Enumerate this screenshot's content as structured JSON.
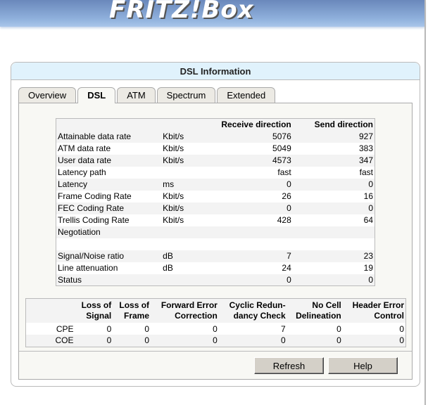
{
  "logo": "FRITZ!Box",
  "title": "DSL Information",
  "tabs": [
    "Overview",
    "DSL",
    "ATM",
    "Spectrum",
    "Extended"
  ],
  "active_tab": "DSL",
  "dsl_table": {
    "headers": [
      "",
      "",
      "Receive direction",
      "Send direction"
    ],
    "rows": [
      [
        "Attainable data rate",
        "Kbit/s",
        "5076",
        "927"
      ],
      [
        "ATM data rate",
        "Kbit/s",
        "5049",
        "383"
      ],
      [
        "User data rate",
        "Kbit/s",
        "4573",
        "347"
      ],
      [
        "Latency path",
        "",
        "fast",
        "fast"
      ],
      [
        "Latency",
        "ms",
        "0",
        "0"
      ],
      [
        "Frame Coding Rate",
        "Kbit/s",
        "26",
        "16"
      ],
      [
        "FEC Coding Rate",
        "Kbit/s",
        "0",
        "0"
      ],
      [
        "Trellis Coding Rate",
        "Kbit/s",
        "428",
        "64"
      ],
      [
        "Negotiation",
        "",
        "",
        ""
      ],
      [
        "",
        "",
        "",
        ""
      ],
      [
        "Signal/Noise ratio",
        "dB",
        "7",
        "23"
      ],
      [
        "Line attenuation",
        "dB",
        "24",
        "19"
      ],
      [
        "Status",
        "",
        "0",
        "0"
      ]
    ]
  },
  "error_table": {
    "headers": [
      [
        "Loss of",
        "Signal"
      ],
      [
        "Loss of",
        "Frame"
      ],
      [
        "Forward Error",
        "Correction"
      ],
      [
        "Cyclic Redun-",
        "dancy Check"
      ],
      [
        "No Cell",
        "Delineation"
      ],
      [
        "Header Error",
        "Control"
      ]
    ],
    "rows": [
      [
        "CPE",
        "0",
        "0",
        "0",
        "7",
        "0",
        "0"
      ],
      [
        "COE",
        "0",
        "0",
        "0",
        "0",
        "0",
        "0"
      ]
    ]
  },
  "buttons": {
    "refresh": "Refresh",
    "help": "Help"
  }
}
